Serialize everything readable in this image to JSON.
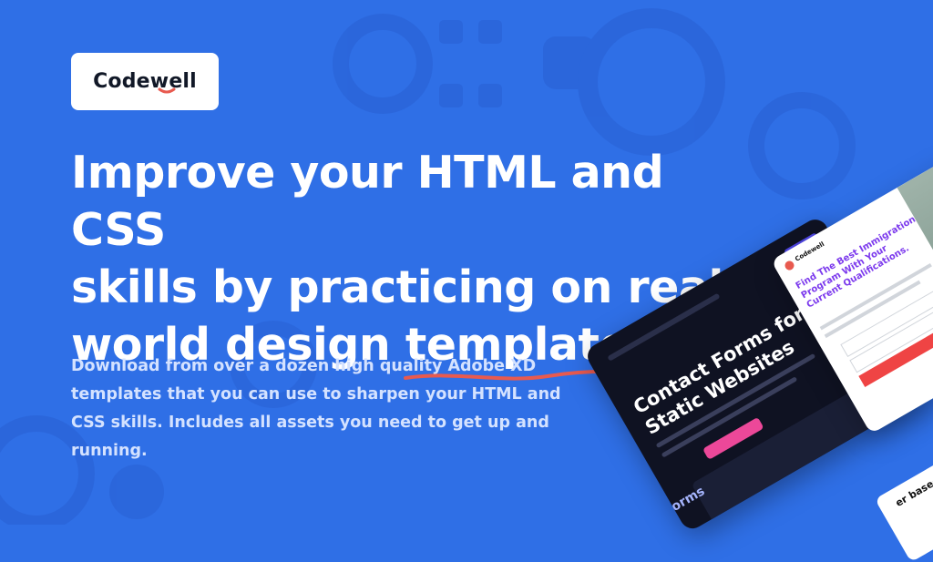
{
  "brand": {
    "logo_text": "Codewell"
  },
  "headline": {
    "line1": "Improve your HTML and CSS",
    "line2": "skills by practicing on real",
    "line3_before": "world design ",
    "line3_underlined": "templates.",
    "accent_color": "#e85a4f"
  },
  "description": {
    "text": "Download from over a dozen high quality Adobe XD templates that you can use to sharpen your HTML and CSS skills. Includes all assets you need to get up and running."
  },
  "mockups": {
    "dark": {
      "title": "Contact Forms for Static Websites",
      "brand": "Forms"
    },
    "light": {
      "brand": "Codewell",
      "title": "Find The Best Immigration Program With Your Current Qualifications."
    },
    "bottom": {
      "text": "er based in"
    }
  },
  "colors": {
    "background": "#2f6fe6",
    "accent": "#e85a4f",
    "text": "#ffffff"
  }
}
